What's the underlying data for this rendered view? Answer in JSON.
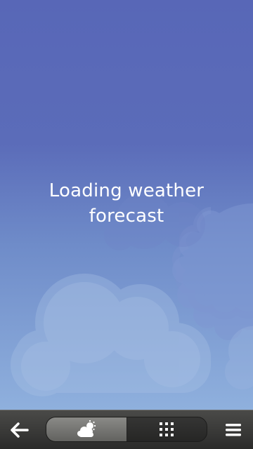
{
  "status": {
    "loading_text_line1": "Loading weather",
    "loading_text_line2": "forecast"
  },
  "colors": {
    "background_top": "#5867b7",
    "background_bottom": "#8fb0dd",
    "toolbar": "#3a3a39",
    "text": "#ffffff"
  },
  "toolbar": {
    "back_icon": "back-arrow-icon",
    "tabs": [
      {
        "icon": "weather-cloud-sun-icon",
        "selected": true
      },
      {
        "icon": "grid-icon",
        "selected": false
      }
    ],
    "menu_icon": "hamburger-menu-icon"
  }
}
